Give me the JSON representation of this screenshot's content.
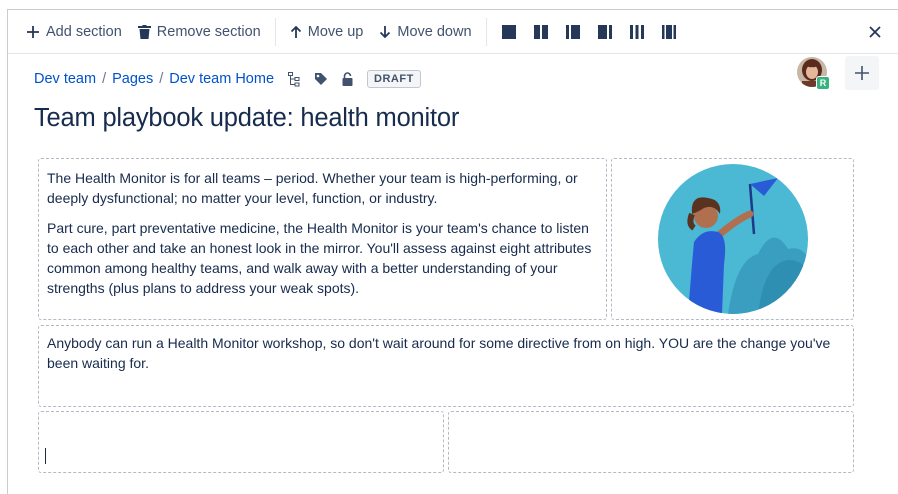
{
  "toolbar": {
    "add_section": "Add section",
    "remove_section": "Remove section",
    "move_up": "Move up",
    "move_down": "Move down"
  },
  "breadcrumb": {
    "items": [
      "Dev team",
      "Pages",
      "Dev team Home"
    ],
    "separator": "/",
    "status": "DRAFT"
  },
  "collaborator": {
    "badge": "R"
  },
  "page": {
    "title": "Team playbook update: health monitor"
  },
  "content": {
    "cell1": {
      "p1": "The Health Monitor is for all teams – period. Whether your team is high-performing, or deeply dysfunctional; no matter your level, function, or industry.",
      "p2": "Part cure, part preventative medicine, the Health Monitor is your team's chance to listen to each other and take an honest look in the mirror. You'll assess against eight attributes common among healthy teams, and walk away with a better understanding of your strengths (plus plans to address your weak spots)."
    },
    "cell3": {
      "p1": "Anybody can run a Health Monitor workshop, so don't wait around for some directive from on high. YOU are the change you've been waiting for."
    }
  },
  "colors": {
    "link": "#0052cc",
    "text": "#172b4d",
    "badge": "#36b37e",
    "illustration_bg": "#4bb8d4",
    "flag": "#2a5bd7"
  }
}
